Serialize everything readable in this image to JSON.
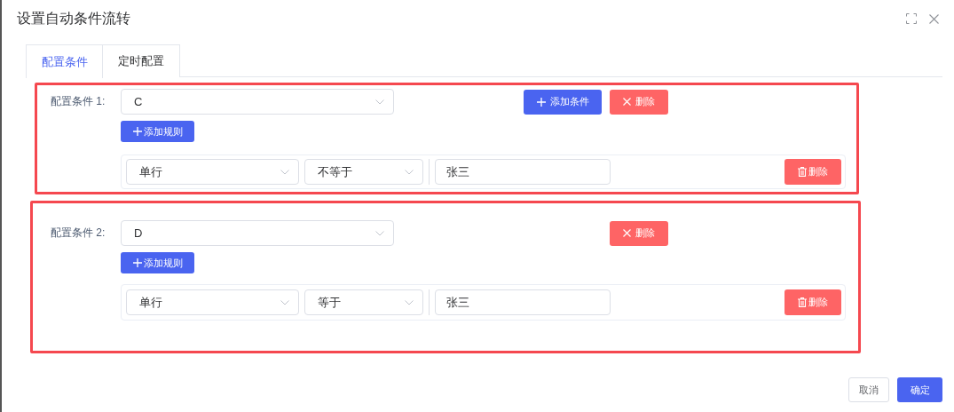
{
  "dialog": {
    "title": "设置自动条件流转"
  },
  "tabs": [
    {
      "label": "配置条件",
      "selected": true
    },
    {
      "label": "定时配置",
      "selected": false
    }
  ],
  "conditions": [
    {
      "label": "配置条件 1:",
      "value": "C",
      "actions": [
        {
          "kind": "add",
          "label": "添加条件"
        },
        {
          "kind": "delete",
          "label": "删除"
        }
      ],
      "add_rule": "添加规则",
      "rules": [
        {
          "field": "单行",
          "operator": "不等于",
          "value": "张三",
          "delete": "删除"
        }
      ]
    },
    {
      "label": "配置条件 2:",
      "value": "D",
      "actions": [
        {
          "kind": "delete",
          "label": "删除"
        }
      ],
      "add_rule": "添加规则",
      "rules": [
        {
          "field": "单行",
          "operator": "等于",
          "value": "张三",
          "delete": "删除"
        }
      ]
    }
  ],
  "footer": {
    "cancel": "取消",
    "confirm": "确定"
  }
}
